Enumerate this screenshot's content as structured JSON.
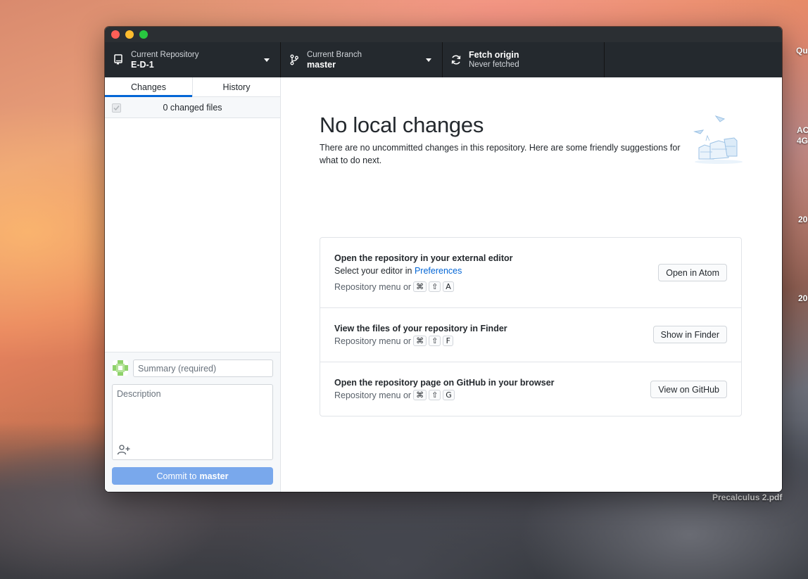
{
  "desktop": {
    "right_labels": [
      "Qu",
      "AC",
      "4G",
      "20",
      "20"
    ],
    "file_label": "Precalculus 2.pdf"
  },
  "toolbar": {
    "repo": {
      "small": "Current Repository",
      "big": "E-D-1",
      "icon": "repo-icon"
    },
    "branch": {
      "small": "Current Branch",
      "big": "master",
      "icon": "branch-icon"
    },
    "fetch": {
      "big": "Fetch origin",
      "small": "Never fetched",
      "icon": "sync-icon"
    }
  },
  "sidebar": {
    "tabs": [
      {
        "label": "Changes",
        "active": true
      },
      {
        "label": "History",
        "active": false
      }
    ],
    "changed_files": "0 changed files",
    "commit": {
      "summary_placeholder": "Summary (required)",
      "description_placeholder": "Description",
      "button_prefix": "Commit to",
      "button_branch": "master"
    }
  },
  "main": {
    "heading": "No local changes",
    "lede": "There are no uncommitted changes in this repository. Here are some friendly suggestions for what to do next.",
    "suggestions": [
      {
        "title": "Open the repository in your external editor",
        "subtitle_prefix": "Select your editor in",
        "subtitle_link": "Preferences",
        "hint": "Repository menu or",
        "keys": [
          "⌘",
          "⇧",
          "A"
        ],
        "button": "Open in Atom"
      },
      {
        "title": "View the files of your repository in Finder",
        "hint": "Repository menu or",
        "keys": [
          "⌘",
          "⇧",
          "F"
        ],
        "button": "Show in Finder"
      },
      {
        "title": "Open the repository page on GitHub in your browser",
        "hint": "Repository menu or",
        "keys": [
          "⌘",
          "⇧",
          "G"
        ],
        "button": "View on GitHub"
      }
    ]
  },
  "colors": {
    "toolbar_bg": "#24292e",
    "accent_blue": "#0366d6",
    "commit_button": "#79a8ec"
  }
}
